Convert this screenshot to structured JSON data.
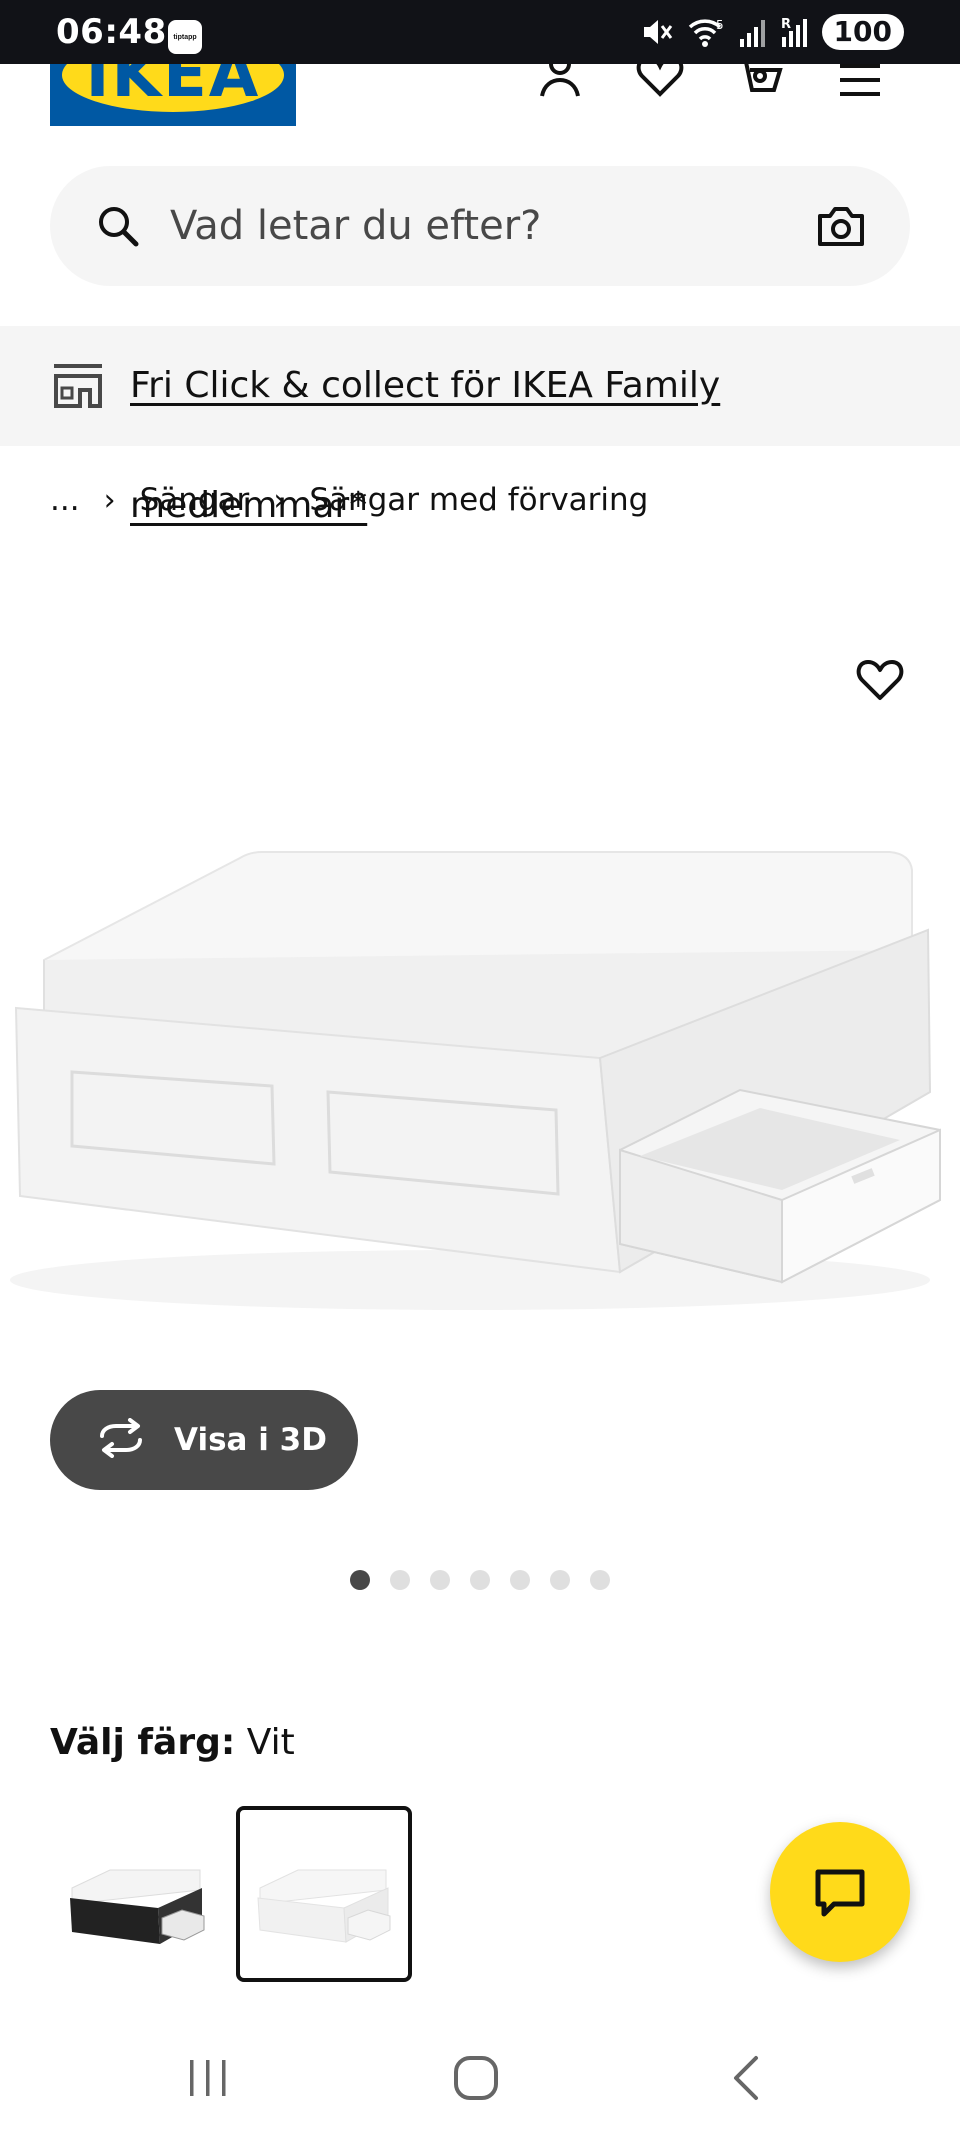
{
  "status_bar": {
    "time": "06:48",
    "app_badge": "tiptapp",
    "network_label": "5",
    "roaming_label": "R",
    "battery": "100"
  },
  "header": {
    "logo_text": "IKEA",
    "icons": [
      "account-icon",
      "favorites-icon",
      "cart-icon",
      "menu-icon"
    ]
  },
  "search": {
    "placeholder": "Vad letar du efter?",
    "icon": "search-icon",
    "camera_icon": "camera-icon"
  },
  "promo": {
    "text": "Fri Click & collect för IKEA Family medlemmar*",
    "icon": "store-icon"
  },
  "breadcrumb": {
    "ellipsis": "...",
    "items": [
      "Sängar",
      "Sängar med förvaring"
    ]
  },
  "product": {
    "view_3d_label": "Visa i 3D",
    "image_count": 7,
    "active_image_index": 0
  },
  "color_selector": {
    "label": "Välj färg:",
    "value": "Vit",
    "options": [
      {
        "name": "black",
        "selected": false
      },
      {
        "name": "white",
        "selected": true
      }
    ]
  },
  "colors": {
    "ikea_blue": "#0058a3",
    "ikea_yellow": "#ffda1a",
    "dark_gray": "#484848",
    "light_gray": "#f5f5f5"
  }
}
